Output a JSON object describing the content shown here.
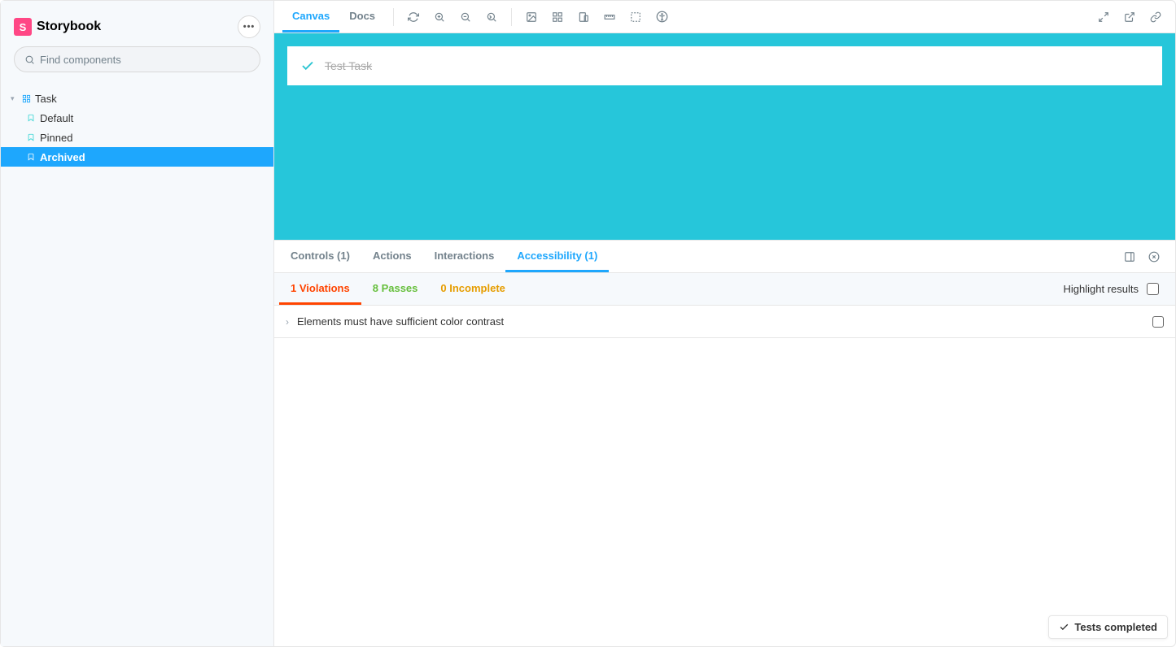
{
  "brand": {
    "name": "Storybook"
  },
  "search": {
    "placeholder": "Find components"
  },
  "tree": {
    "group": "Task",
    "items": [
      {
        "label": "Default",
        "selected": false
      },
      {
        "label": "Pinned",
        "selected": false
      },
      {
        "label": "Archived",
        "selected": true
      }
    ]
  },
  "toolbar": {
    "tabs": {
      "canvas": "Canvas",
      "docs": "Docs"
    }
  },
  "canvas": {
    "background": "#26c6da",
    "task": {
      "title": "Test Task",
      "state": "archived"
    }
  },
  "addons": {
    "tabs": {
      "controls": "Controls (1)",
      "actions": "Actions",
      "interactions": "Interactions",
      "accessibility": "Accessibility (1)"
    },
    "a11y": {
      "subtabs": {
        "violations": "1 Violations",
        "passes": "8 Passes",
        "incomplete": "0 Incomplete"
      },
      "highlight_label": "Highlight results",
      "items": [
        "Elements must have sufficient color contrast"
      ]
    }
  },
  "status": {
    "text": "Tests completed"
  }
}
